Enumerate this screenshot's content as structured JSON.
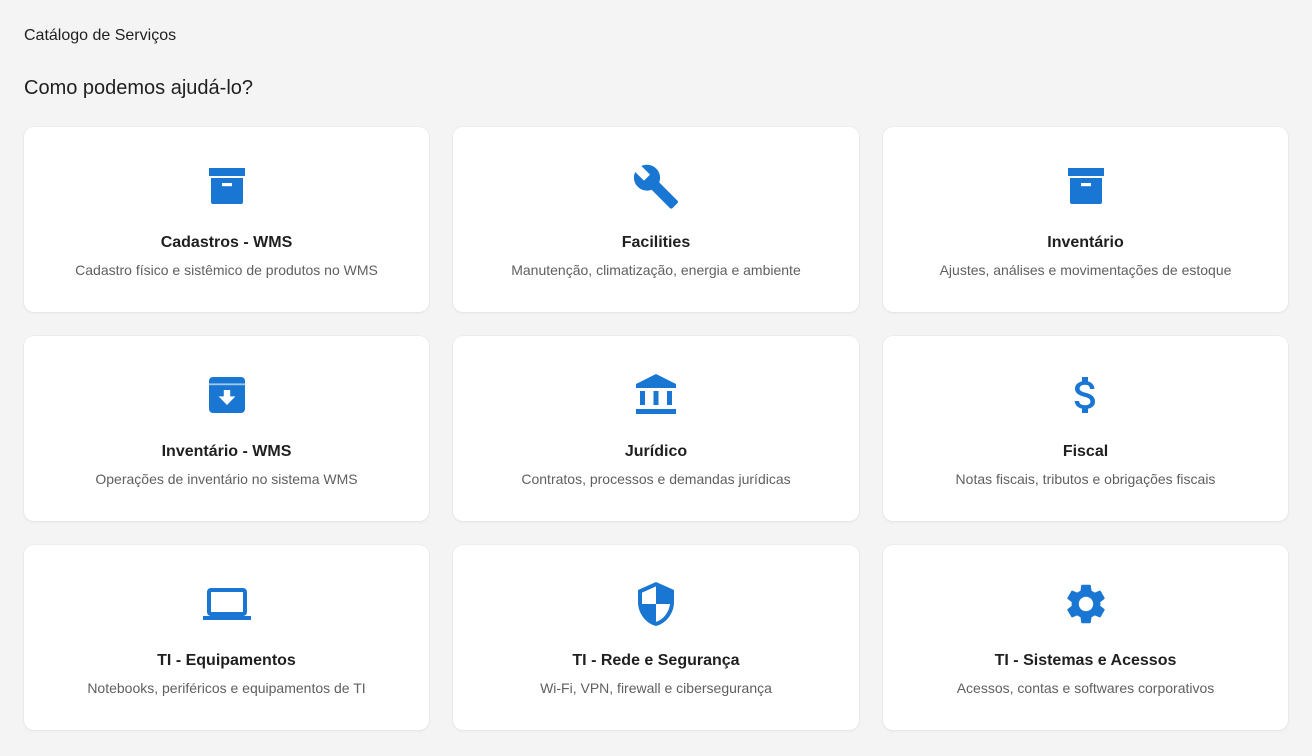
{
  "breadcrumb": "Catálogo de Serviços",
  "heading": "Como podemos ajudá-lo?",
  "accent_color": "#1976d2",
  "cards": [
    {
      "icon": "archive-box-icon",
      "title": "Cadastros - WMS",
      "description": "Cadastro físico e sistêmico de produtos no WMS"
    },
    {
      "icon": "wrench-icon",
      "title": "Facilities",
      "description": "Manutenção, climatização, energia e ambiente"
    },
    {
      "icon": "archive-box-icon",
      "title": "Inventário",
      "description": "Ajustes, análises e movimentações de estoque"
    },
    {
      "icon": "archive-download-icon",
      "title": "Inventário - WMS",
      "description": "Operações de inventário no sistema WMS"
    },
    {
      "icon": "bank-icon",
      "title": "Jurídico",
      "description": "Contratos, processos e demandas jurídicas"
    },
    {
      "icon": "dollar-icon",
      "title": "Fiscal",
      "description": "Notas fiscais, tributos e obrigações fiscais"
    },
    {
      "icon": "laptop-icon",
      "title": "TI - Equipamentos",
      "description": "Notebooks, periféricos e equipamentos de TI"
    },
    {
      "icon": "shield-icon",
      "title": "TI - Rede e Segurança",
      "description": "Wi-Fi, VPN, firewall e cibersegurança"
    },
    {
      "icon": "gear-icon",
      "title": "TI - Sistemas e Acessos",
      "description": "Acessos, contas e softwares corporativos"
    }
  ]
}
